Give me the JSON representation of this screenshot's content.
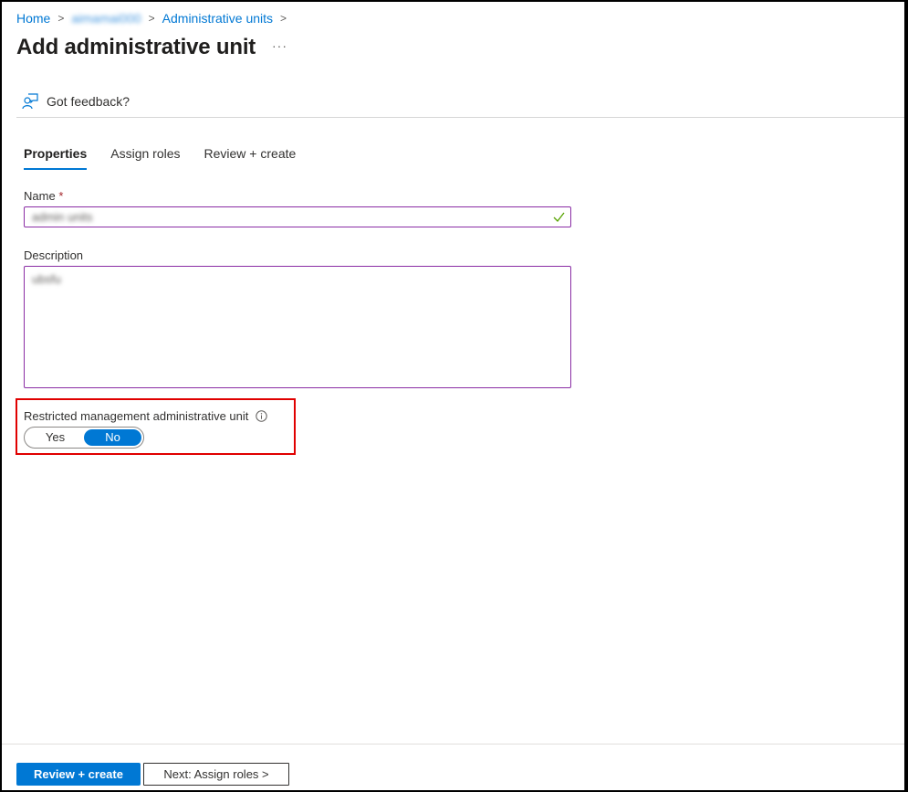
{
  "breadcrumb": {
    "items": [
      "Home",
      "aimamai000",
      "Administrative units"
    ],
    "separator": ">"
  },
  "header": {
    "title": "Add administrative unit",
    "more_label": "···"
  },
  "feedback": {
    "label": "Got feedback?",
    "icon": "feedback-person-icon"
  },
  "tabs": [
    {
      "label": "Properties",
      "active": true
    },
    {
      "label": "Assign roles",
      "active": false
    },
    {
      "label": "Review + create",
      "active": false
    }
  ],
  "form": {
    "name": {
      "label": "Name",
      "required_marker": "*",
      "value": "admin units",
      "valid": true
    },
    "description": {
      "label": "Description",
      "value": "ubsfu"
    },
    "restricted": {
      "label": "Restricted management administrative unit",
      "options": [
        "Yes",
        "No"
      ],
      "selected": "No"
    }
  },
  "footer": {
    "primary_label": "Review + create",
    "secondary_label": "Next: Assign roles >"
  },
  "colors": {
    "accent": "#0078d4",
    "input_border": "#8a2da5",
    "valid_check": "#57a300",
    "highlight_box": "#e00000",
    "required": "#a4262c"
  }
}
